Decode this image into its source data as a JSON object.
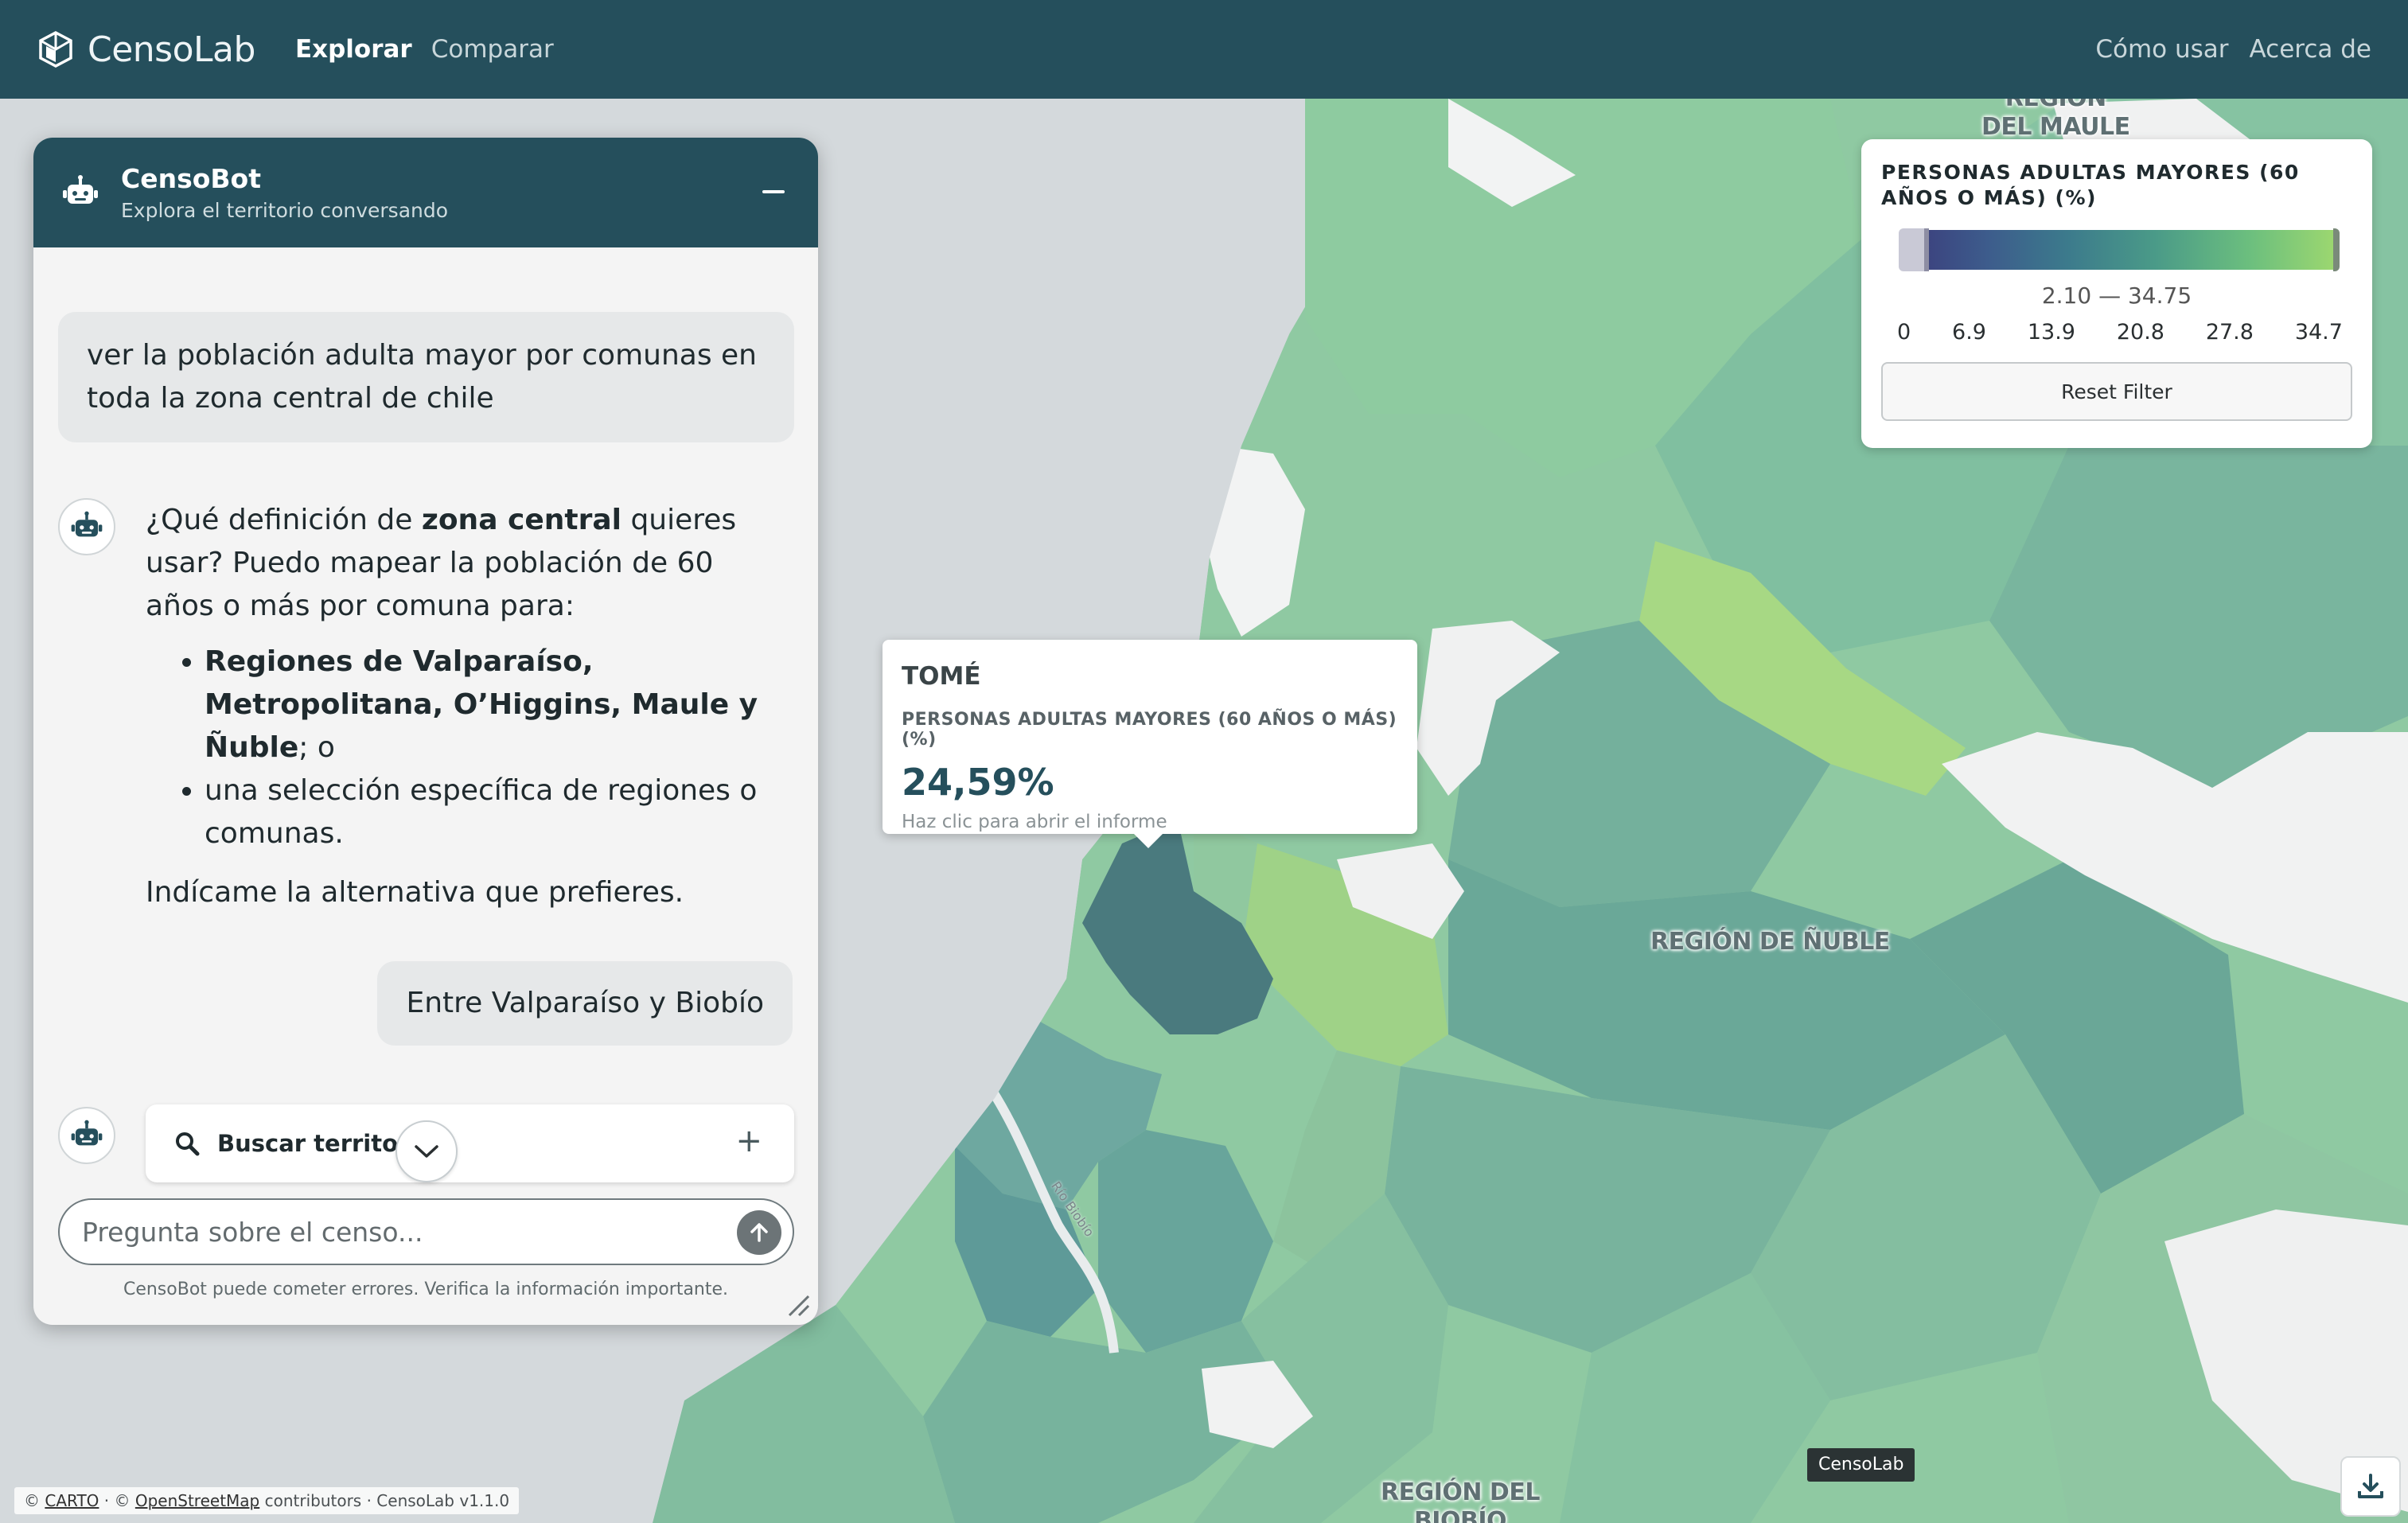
{
  "app": {
    "name": "CensoLab",
    "nav": {
      "explore": "Explorar",
      "compare": "Comparar",
      "how_to": "Cómo usar",
      "about": "Acerca de"
    },
    "brand_color": "#254f5c"
  },
  "chat": {
    "title": "CensoBot",
    "subtitle": "Explora el territorio conversando",
    "messages": {
      "user1": "ver la población adulta mayor por comunas en toda la zona central de chile",
      "bot_intro_pre": "¿Qué definición de ",
      "bot_intro_bold": "zona central",
      "bot_intro_post": " quieres usar? Puedo mapear la población de 60 años o más por comuna para:",
      "bot_option1_bold": "Regiones de Valparaíso, Metropolitana, O’Higgins, Maule y Ñuble",
      "bot_option1_tail": "; o",
      "bot_option2": "una selección específica de regiones o comunas.",
      "bot_outro": "Indícame la alternativa que prefieres.",
      "user2": "Entre Valparaíso y Biobío"
    },
    "search_label": "Buscar territorio",
    "input_placeholder": "Pregunta sobre el censo...",
    "disclaimer": "CensoBot puede cometer errores. Verifica la información importante."
  },
  "tooltip": {
    "commune": "TOMÉ",
    "variable": "PERSONAS ADULTAS MAYORES (60 AÑOS O MÁS) (%)",
    "value": "24,59%",
    "hint": "Haz clic para abrir el informe"
  },
  "legend": {
    "title": "PERSONAS ADULTAS MAYORES (60 AÑOS O MÁS) (%)",
    "range_text": "2.10 — 34.75",
    "ticks": [
      "0",
      "6.9",
      "13.9",
      "20.8",
      "27.8",
      "34.7"
    ],
    "reset_label": "Reset Filter",
    "filter_min": 2.1,
    "filter_max": 34.75
  },
  "map": {
    "labels": {
      "maule_line1": "REGIÓN",
      "maule_line2": "DEL MAULE",
      "nuble": "REGIÓN DE ÑUBLE",
      "biobio_line1": "REGIÓN DEL",
      "biobio_line2": "BIOBÍO",
      "small_place": "Río Biobío"
    }
  },
  "footer": {
    "attrib_prefix": "© ",
    "carto": "CARTO",
    "sep1": " · © ",
    "osm": "OpenStreetMap",
    "attrib_suffix": " contributors · CensoLab v1.1.0",
    "badge": "CensoLab"
  }
}
